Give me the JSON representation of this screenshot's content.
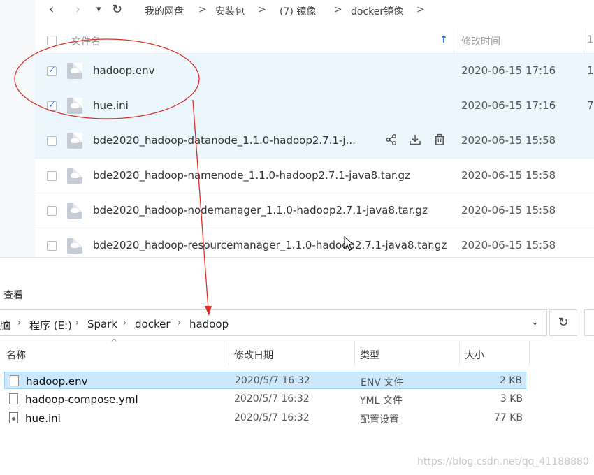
{
  "cloud": {
    "nav": {
      "back_glyph": "‹",
      "forward_glyph": "›",
      "dropdown_glyph": "▾",
      "refresh_glyph": "↻",
      "breadcrumbs": [
        "我的网盘",
        "安装包",
        "(7) 镜像",
        "docker镜像"
      ],
      "separator": ">"
    },
    "header": {
      "name_label": "文件名",
      "modified_label": "修改时间",
      "sort_glyph": "↑",
      "extra_glyph": "1"
    },
    "rows": [
      {
        "name": "hadoop.env",
        "date": "2020-06-15 17:16",
        "checked": true,
        "cut": "1"
      },
      {
        "name": "hue.ini",
        "date": "2020-06-15 17:16",
        "checked": true,
        "cut": "7"
      },
      {
        "name": "bde2020_hadoop-datanode_1.1.0-hadoop2.7.1-j...",
        "date": "2020-06-15 15:58",
        "checked": false,
        "cut": ""
      },
      {
        "name": "bde2020_hadoop-namenode_1.1.0-hadoop2.7.1-java8.tar.gz",
        "date": "2020-06-15 15:58",
        "checked": false,
        "cut": ""
      },
      {
        "name": "bde2020_hadoop-nodemanager_1.1.0-hadoop2.7.1-java8.tar.gz",
        "date": "2020-06-15 15:58",
        "checked": false,
        "cut": ""
      },
      {
        "name": "bde2020_hadoop-resourcemanager_1.1.0-hadoop2.7.1-java8.tar.gz",
        "date": "2020-06-15 15:58",
        "checked": false,
        "cut": ""
      }
    ],
    "row_action_icons": [
      "share-icon",
      "download-icon",
      "trash-icon"
    ],
    "row_action_glyphs": [
      "⚯",
      "⤓",
      "🗑"
    ]
  },
  "explorer": {
    "ribbon_tab": "查看",
    "address": {
      "crumbs": [
        "脑",
        "程序 (E:)",
        "Spark",
        "docker",
        "hadoop"
      ],
      "separator": "›",
      "chevron_glyph": "⌄",
      "refresh_glyph": "↻"
    },
    "columns": {
      "name": "名称",
      "date": "修改日期",
      "type": "类型",
      "size": "大小"
    },
    "sort_caret": "^",
    "files": [
      {
        "name": "hadoop.env",
        "date": "2020/5/7 16:32",
        "type": "ENV 文件",
        "size": "2 KB",
        "selected": true
      },
      {
        "name": "hadoop-compose.yml",
        "date": "2020/5/7 16:32",
        "type": "YML 文件",
        "size": "3 KB",
        "selected": false
      },
      {
        "name": "hue.ini",
        "date": "2020/5/7 16:32",
        "type": "配置设置",
        "size": "77 KB",
        "selected": false
      }
    ]
  },
  "watermark": "https://blog.csdn.net/qq_41188880",
  "colors": {
    "selection": "#ecf6fd",
    "checkbox": "#2a73e8",
    "explorer_selection": "#cce8ff",
    "annotation": "#d93025"
  }
}
